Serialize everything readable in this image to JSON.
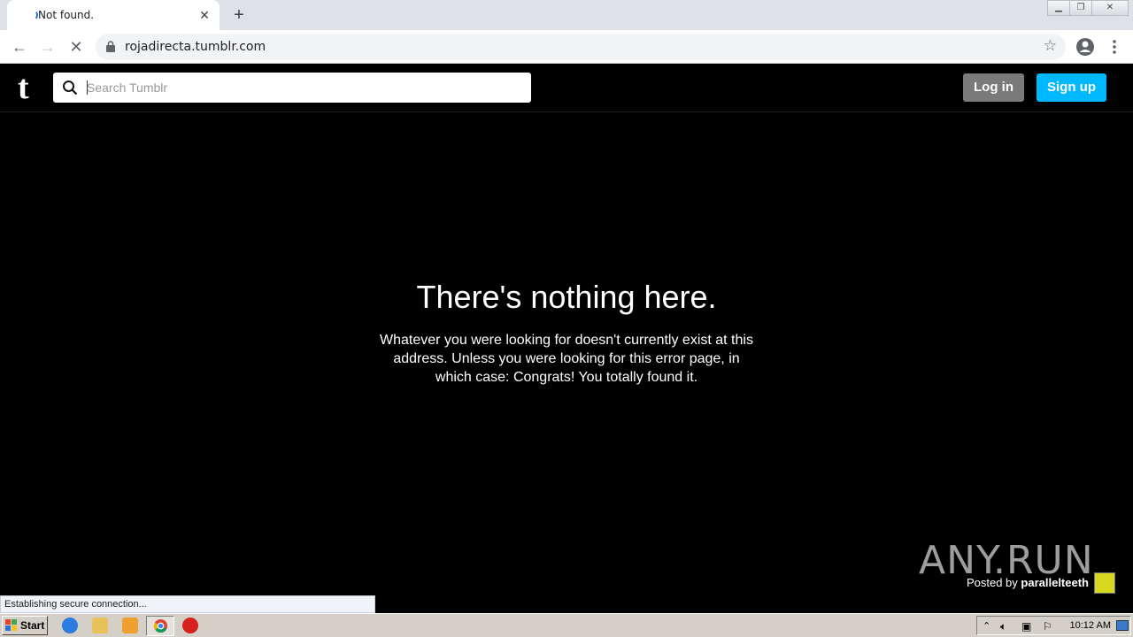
{
  "browser": {
    "tab_title": "Not found.",
    "new_tab_label": "+",
    "url": "rojadirecta.tumblr.com"
  },
  "tumblr": {
    "logo": "t",
    "search_placeholder": "Search Tumblr",
    "login_label": "Log in",
    "signup_label": "Sign up",
    "accent_color": "#00b8ff"
  },
  "message": {
    "title": "There's nothing here.",
    "body": "Whatever you were looking for doesn't currently exist at this address. Unless you were looking for this error page, in which case: Congrats! You totally found it."
  },
  "posted_by": {
    "prefix": "Posted by",
    "author": "parallelteeth"
  },
  "status_text": "Establishing secure connection...",
  "watermark": "ANY.RUN",
  "taskbar": {
    "start_label": "Start",
    "clock": "10:12 AM"
  }
}
